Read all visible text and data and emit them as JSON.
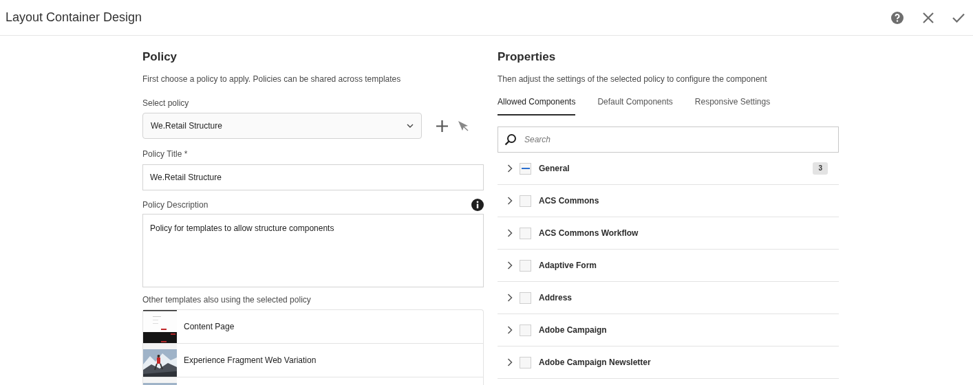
{
  "window": {
    "title": "Layout Container Design",
    "actions": [
      {
        "kind": "help"
      },
      {
        "kind": "close"
      },
      {
        "kind": "done"
      }
    ]
  },
  "policy": {
    "heading": "Policy",
    "description": "First choose a policy to apply. Policies can be shared across templates",
    "select_label": "Select policy",
    "select_value": "We.Retail Structure",
    "title_label": "Policy Title *",
    "title_value": "We.Retail Structure",
    "description_label": "Policy Description",
    "description_value": "Policy for templates to allow structure components",
    "templates_label": "Other templates also using the selected policy",
    "templates": [
      {
        "kind": "page",
        "name": "Content Page"
      },
      {
        "kind": "picture",
        "name": "Experience Fragment Web Variation"
      },
      {
        "kind": "picture"
      }
    ]
  },
  "properties": {
    "heading": "Properties",
    "description": "Then adjust the settings of the selected policy to configure the component",
    "tabs": [
      {
        "label": "Allowed Components",
        "selected": true
      },
      {
        "label": "Default Components",
        "selected": false
      },
      {
        "label": "Responsive Settings",
        "selected": false
      }
    ],
    "search": {
      "placeholder": "Search"
    },
    "groups": [
      {
        "name": "General",
        "indeterminate": true,
        "count": "3"
      },
      {
        "name": "ACS Commons",
        "indeterminate": false
      },
      {
        "name": "ACS Commons Workflow",
        "indeterminate": false
      },
      {
        "name": "Adaptive Form",
        "indeterminate": false
      },
      {
        "name": "Address",
        "indeterminate": false
      },
      {
        "name": "Adobe Campaign",
        "indeterminate": false
      },
      {
        "name": "Adobe Campaign Newsletter",
        "indeterminate": false
      }
    ]
  }
}
